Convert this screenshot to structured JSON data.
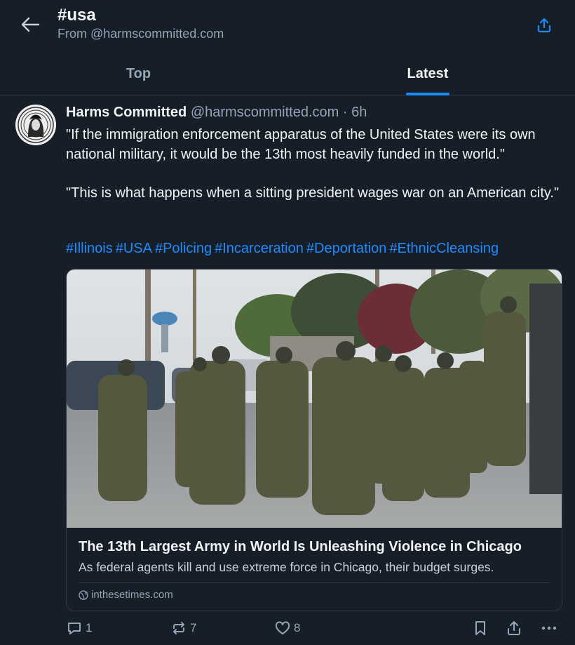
{
  "header": {
    "title": "#usa",
    "subtitle": "From @harmscommitted.com"
  },
  "tabs": [
    {
      "label": "Top",
      "active": false
    },
    {
      "label": "Latest",
      "active": true
    }
  ],
  "post": {
    "author": "Harms Committed",
    "handle": "@harmscommitted.com",
    "separator": " · ",
    "time": "6h",
    "paragraph1": "\"If the immigration enforcement apparatus of the United States were its own national military, it would be the 13th most heavily funded in the world.\"",
    "paragraph2": "\"This is what happens when a sitting president wages war on an American city.\"",
    "hashtags": [
      "#Illinois",
      "#USA",
      "#Policing",
      "#Incarceration",
      "#Deportation",
      "#EthnicCleansing"
    ],
    "card": {
      "title": "The 13th Largest Army in World Is Unleashing Violence in Chicago",
      "description": "As federal agents kill and use extreme force in Chicago, their budget surges.",
      "domain": "inthesetimes.com"
    },
    "stats": {
      "replies": "1",
      "reposts": "7",
      "likes": "8"
    }
  },
  "icons": {
    "back": "arrow-left-icon",
    "share": "share-icon",
    "reply": "speech-bubble-icon",
    "repost": "repost-icon",
    "like": "heart-icon",
    "bookmark": "bookmark-icon",
    "more": "ellipsis-icon",
    "globe": "globe-icon"
  },
  "colors": {
    "background": "#161e27",
    "accent": "#208bfe",
    "muted": "#93a5b7"
  }
}
